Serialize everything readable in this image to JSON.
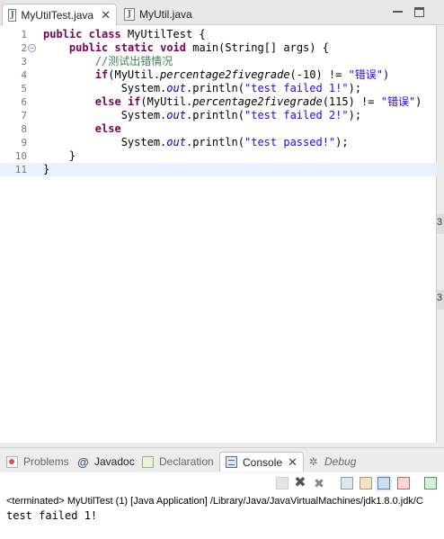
{
  "editor_tabs": [
    {
      "label": "MyUtilTest.java",
      "active": true,
      "closable": true,
      "icon": "java-file-icon"
    },
    {
      "label": "MyUtil.java",
      "active": false,
      "closable": false,
      "icon": "java-file-icon"
    }
  ],
  "close_glyph": "✕",
  "java_icon_glyph": "J",
  "code_lines": [
    {
      "n": "1",
      "t": [
        [
          "kw",
          "public"
        ],
        [
          "p",
          " "
        ],
        [
          "kw",
          "class"
        ],
        [
          "p",
          " MyUtilTest {"
        ]
      ]
    },
    {
      "n": "2",
      "fold": true,
      "t": [
        [
          "p",
          "    "
        ],
        [
          "kw",
          "public"
        ],
        [
          "p",
          " "
        ],
        [
          "kw",
          "static"
        ],
        [
          "p",
          " "
        ],
        [
          "kw",
          "void"
        ],
        [
          "p",
          " main(String[] args) {"
        ]
      ]
    },
    {
      "n": "3",
      "t": [
        [
          "p",
          "        "
        ],
        [
          "cmt",
          "//测试出错情况"
        ]
      ]
    },
    {
      "n": "4",
      "t": [
        [
          "p",
          "        "
        ],
        [
          "kw",
          "if"
        ],
        [
          "p",
          "(MyUtil."
        ],
        [
          "smth",
          "percentage2fivegrade"
        ],
        [
          "p",
          "(-10) != "
        ],
        [
          "str",
          "\"错误\""
        ],
        [
          "p",
          ")"
        ]
      ]
    },
    {
      "n": "5",
      "t": [
        [
          "p",
          "            System."
        ],
        [
          "fld",
          "out"
        ],
        [
          "p",
          ".println("
        ],
        [
          "str",
          "\"test failed 1!\""
        ],
        [
          "p",
          ");"
        ]
      ]
    },
    {
      "n": "6",
      "t": [
        [
          "p",
          "        "
        ],
        [
          "kw",
          "else"
        ],
        [
          "p",
          " "
        ],
        [
          "kw",
          "if"
        ],
        [
          "p",
          "(MyUtil."
        ],
        [
          "smth",
          "percentage2fivegrade"
        ],
        [
          "p",
          "(115) != "
        ],
        [
          "str",
          "\"错误\""
        ],
        [
          "p",
          ")"
        ]
      ]
    },
    {
      "n": "7",
      "t": [
        [
          "p",
          "            System."
        ],
        [
          "fld",
          "out"
        ],
        [
          "p",
          ".println("
        ],
        [
          "str",
          "\"test failed 2!\""
        ],
        [
          "p",
          ");"
        ]
      ]
    },
    {
      "n": "8",
      "t": [
        [
          "p",
          "        "
        ],
        [
          "kw",
          "else"
        ]
      ]
    },
    {
      "n": "9",
      "t": [
        [
          "p",
          "            System."
        ],
        [
          "fld",
          "out"
        ],
        [
          "p",
          ".println("
        ],
        [
          "str",
          "\"test passed!\""
        ],
        [
          "p",
          ");"
        ]
      ]
    },
    {
      "n": "10",
      "t": [
        [
          "p",
          "    }"
        ]
      ]
    },
    {
      "n": "11",
      "current": true,
      "t": [
        [
          "p",
          "}"
        ]
      ]
    }
  ],
  "fold_glyph": "−",
  "side_stub_text": "3",
  "panel_tabs": [
    {
      "label": "Problems",
      "icon": "problems-icon",
      "active": false
    },
    {
      "label": "Javadoc",
      "icon": "javadoc-icon",
      "active": false
    },
    {
      "label": "Declaration",
      "icon": "declaration-icon",
      "active": false
    },
    {
      "label": "Console",
      "icon": "console-icon",
      "active": true
    },
    {
      "label": "Debug",
      "icon": "debug-icon",
      "active": false
    }
  ],
  "javadoc_glyph": "@",
  "debug_glyph": "✲",
  "console": {
    "terminated_line": "<terminated> MyUtilTest (1) [Java Application] /Library/Java/JavaVirtualMachines/jdk1.8.0.jdk/C",
    "output_lines": [
      "test failed 1!"
    ]
  },
  "toolbar_glyphs": {
    "remove": "✖",
    "remove_all": "✖"
  }
}
